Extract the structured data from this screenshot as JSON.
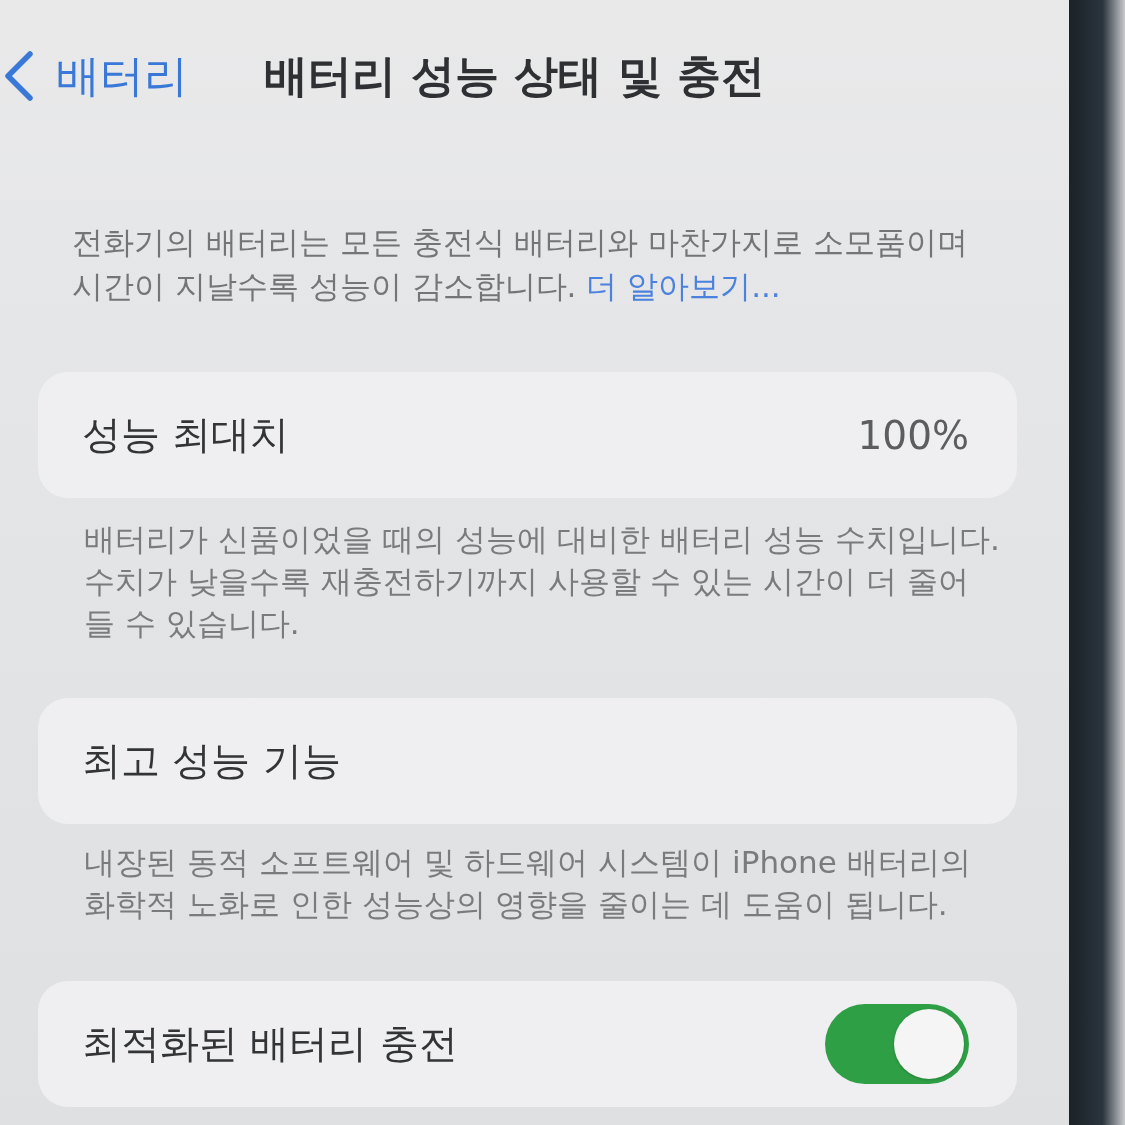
{
  "nav": {
    "back_label": "배터리",
    "title": "배터리 성능 상태 및 충전"
  },
  "intro": {
    "text": "전화기의 배터리는 모든 충전식 배터리와 마찬가지로 소모품이며\n시간이 지날수록 성능이 감소합니다.",
    "link": "더 알아보기..."
  },
  "sections": [
    {
      "kind": "value",
      "label": "성능 최대치",
      "value": "100%",
      "footer": "배터리가 신품이었을 때의 성능에 대비한 배터리 성능 수치입니다.\n수치가 낮을수록 재충전하기까지 사용할 수 있는 시간이 더 줄어\n들 수 있습니다."
    },
    {
      "kind": "plain",
      "label": "최고 성능 기능",
      "footer": "내장된 동적 소프트웨어 및 하드웨어 시스템이 iPhone 배터리의\n화학적 노화로 인한 성능상의 영향을 줄이는 데 도움이 됩니다."
    },
    {
      "kind": "toggle",
      "label": "최적화된 배터리 충전",
      "on": true
    }
  ]
}
